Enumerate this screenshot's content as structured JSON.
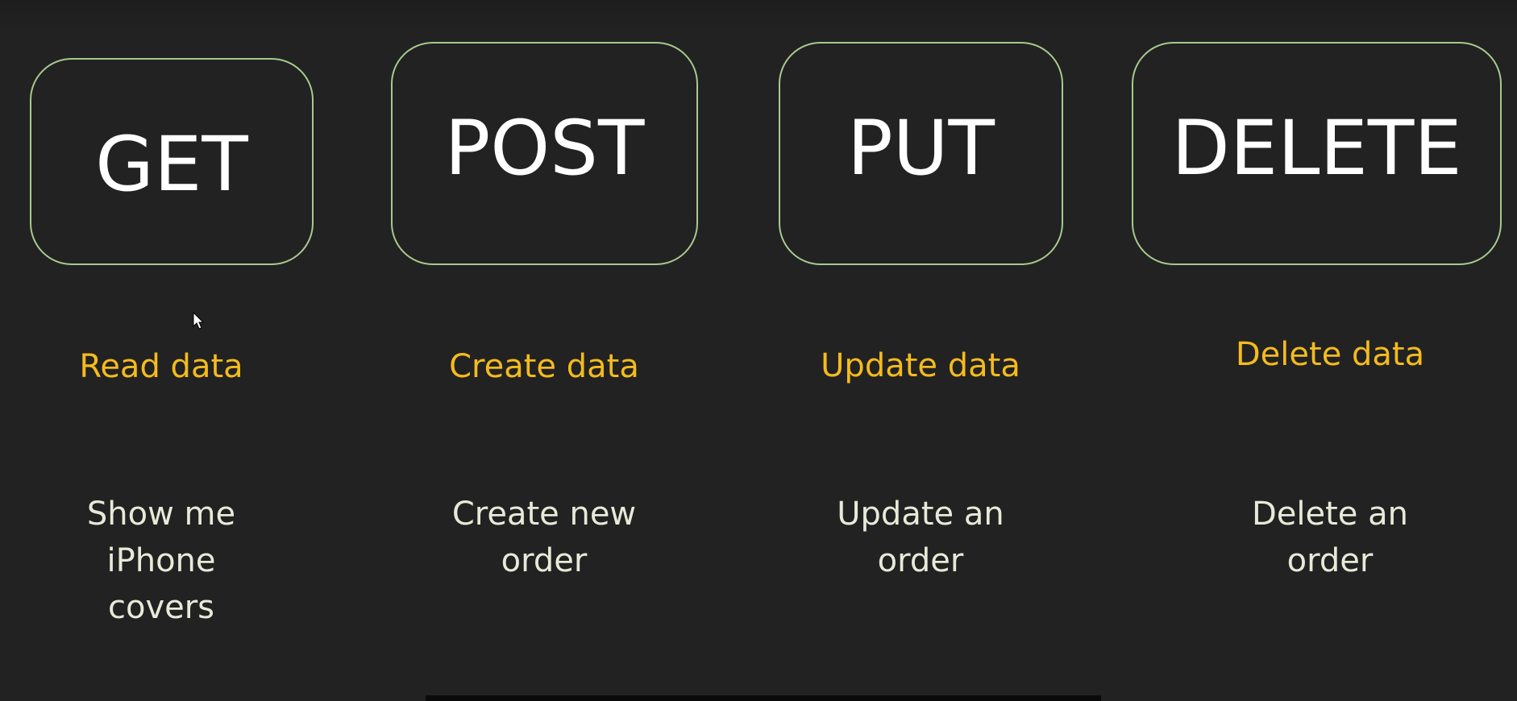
{
  "methods": [
    {
      "name": "GET",
      "action": "Read data",
      "example": "Show me\niPhone\ncovers"
    },
    {
      "name": "POST",
      "action": "Create data",
      "example": "Create new\norder"
    },
    {
      "name": "PUT",
      "action": "Update data",
      "example": "Update an\norder"
    },
    {
      "name": "DELETE",
      "action": "Delete data",
      "example": "Delete an\norder"
    }
  ],
  "colors": {
    "background": "#222222",
    "box_border": "#a8c98d",
    "method_text": "#ffffff",
    "action_text": "#f4bb1d",
    "example_text": "#e7ead8"
  },
  "icons": {
    "cursor": "mouse-pointer-icon"
  }
}
